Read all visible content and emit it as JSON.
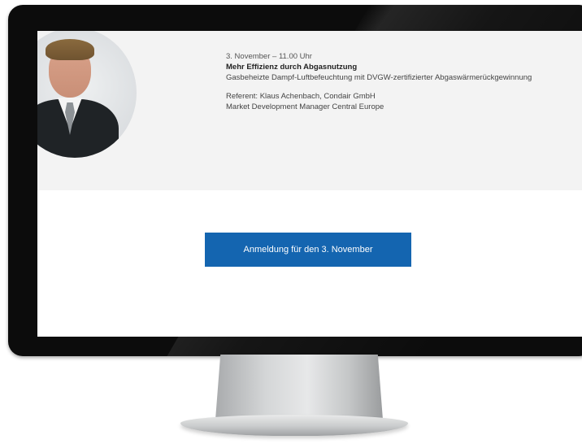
{
  "event": {
    "date_time": "3. November – 11.00 Uhr",
    "title": "Mehr Effizienz durch Abgasnutzung",
    "subtitle": "Gasbeheizte Dampf-Luftbefeuchtung mit DVGW-zertifizierter Abgaswärmerückgewinnung",
    "speaker": "Referent: Klaus Achenbach, Condair GmbH",
    "speaker_role": "Market Development Manager Central Europe"
  },
  "cta": {
    "label": "Anmeldung für den 3. November",
    "color": "#1465b0"
  },
  "colors": {
    "bezel": "#0c0c0c",
    "panel": "#f3f3f3",
    "screen": "#ffffff"
  }
}
